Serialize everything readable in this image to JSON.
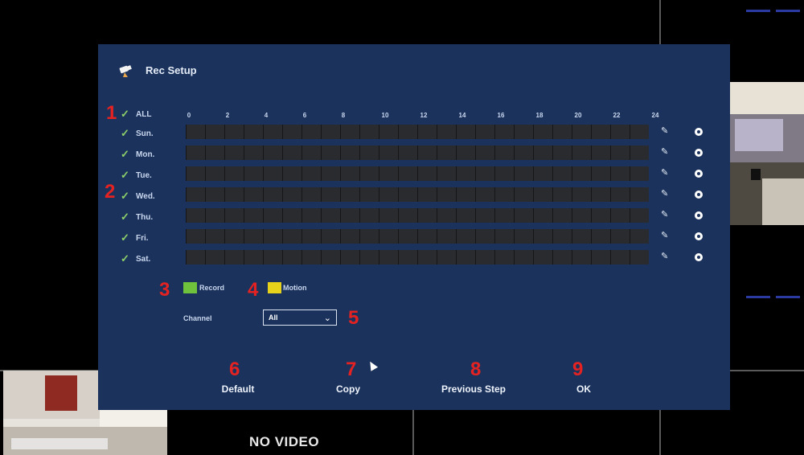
{
  "dialog": {
    "title": "Rec Setup",
    "all_label": "ALL",
    "hours": [
      "0",
      "2",
      "4",
      "6",
      "8",
      "10",
      "12",
      "14",
      "16",
      "18",
      "20",
      "22",
      "24"
    ],
    "days": [
      {
        "label": "Sun."
      },
      {
        "label": "Mon."
      },
      {
        "label": "Tue."
      },
      {
        "label": "Wed."
      },
      {
        "label": "Thu."
      },
      {
        "label": "Fri."
      },
      {
        "label": "Sat."
      }
    ],
    "legend": {
      "record_label": "Record",
      "record_color": "#6ec23c",
      "motion_label": "Motion",
      "motion_color": "#e6d21a"
    },
    "channel": {
      "label": "Channel",
      "value": "All"
    },
    "buttons": {
      "default": "Default",
      "copy": "Copy",
      "previous": "Previous Step",
      "ok": "OK"
    },
    "annotations": [
      "1",
      "2",
      "3",
      "4",
      "5",
      "6",
      "7",
      "8",
      "9"
    ]
  },
  "background": {
    "no_video": "NO VIDEO"
  },
  "colors": {
    "dialog_bg": "#1b335c",
    "annotation": "#e52222",
    "bar_bg": "#2a2b2f"
  }
}
